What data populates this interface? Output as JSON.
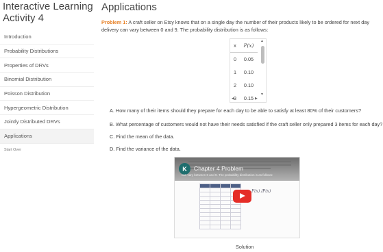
{
  "sidebar": {
    "title": "Interactive Learning Activity 4",
    "items": [
      {
        "label": "Introduction"
      },
      {
        "label": "Probability Distributions"
      },
      {
        "label": "Properties of DRVs"
      },
      {
        "label": "Binomial Distribution"
      },
      {
        "label": "Poisson Distribution"
      },
      {
        "label": "Hypergeometric Distribution"
      },
      {
        "label": "Jointly Distributed DRVs"
      },
      {
        "label": "Applications"
      }
    ],
    "active_index": 7,
    "start_over": "Start Over"
  },
  "main": {
    "title": "Applications",
    "problem_label": "Problem 1:",
    "problem_text": " A craft seller on Etsy knows that on a single day the number of their products likely to be ordered for next day delivery can vary between 0 and 9. The probability distribution is as follows:",
    "table": {
      "headers": [
        "x",
        "P(x)"
      ],
      "rows": [
        {
          "x": "0",
          "p": "0.05"
        },
        {
          "x": "1",
          "p": "0.10"
        },
        {
          "x": "2",
          "p": "0.10"
        },
        {
          "x": "3",
          "p": "0.15"
        }
      ]
    },
    "questions": [
      "A. How many of their items should they prepare for each day to be able to satisfy at least 80% of their customers?",
      "B. What percentage of customers would not have their needs satisfied if the craft seller only prepared 3 items for each day?",
      "C. Find the mean of the data.",
      "D. Find the variance of the data."
    ],
    "video": {
      "channel_initial": "K",
      "title": "Chapter 4 Problem",
      "subtitle": "can vary between 0 and 9. The probability distribution is as follows:"
    },
    "solution_label": "Solution"
  },
  "colors": {
    "accent": "#e67e22",
    "play": "#e52d27",
    "avatar": "#1f6e6e"
  }
}
